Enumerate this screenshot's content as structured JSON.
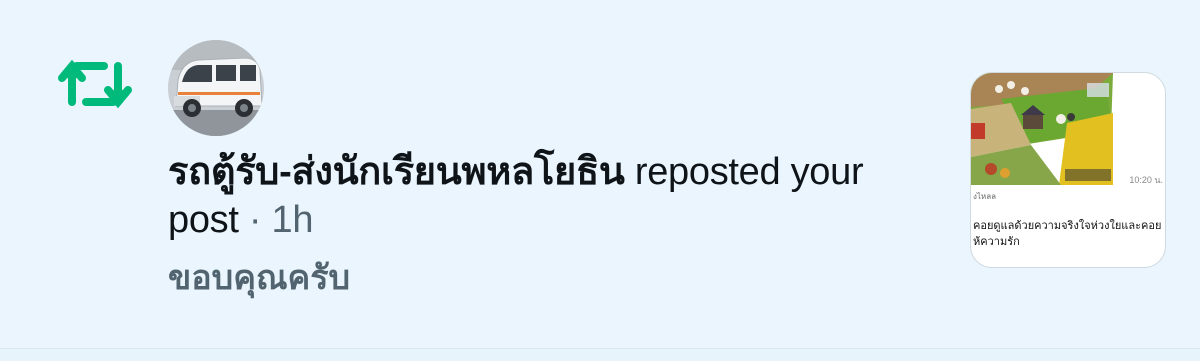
{
  "notification": {
    "type_icon": "repost-icon",
    "accent_color": "#00ba7c",
    "avatar_alt": "avatar",
    "display_name": "รถตู้รับ-ส่งนักเรียนพหลโยธิน",
    "action_text": " reposted your",
    "action_text_2": "post",
    "separator": " · ",
    "timestamp": "1h",
    "post_text": "ขอบคุณครับ"
  },
  "thumbnail": {
    "time_label": "10:20 น.",
    "source_label": "งไหลล",
    "caption": "คอยดูแลด้วยความจริงใจห่วงใยและคอย\nห้ความรัก"
  },
  "colors": {
    "background": "#eaf5fd",
    "text_primary": "#0f1419",
    "text_secondary": "#536471"
  }
}
